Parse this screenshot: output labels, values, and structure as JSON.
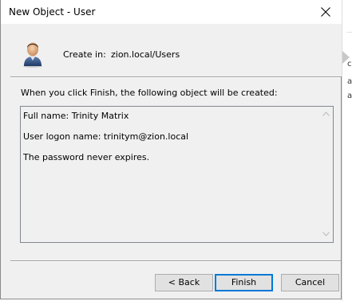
{
  "window": {
    "title": "New Object - User"
  },
  "header": {
    "create_in_label": "Create in:",
    "create_in_path": "zion.local/Users",
    "icon": "user-icon"
  },
  "description": "When you click Finish, the following object will be created:",
  "summary": {
    "lines": [
      "Full name: Trinity Matrix",
      "User logon name: trinitym@zion.local",
      "The password never expires."
    ]
  },
  "buttons": {
    "back": "< Back",
    "finish": "Finish",
    "cancel": "Cancel"
  },
  "colors": {
    "dialog_bg": "#f0f0f0",
    "titlebar_bg": "#ffffff",
    "default_button_border": "#0078d7",
    "button_bg": "#e1e1e1"
  }
}
